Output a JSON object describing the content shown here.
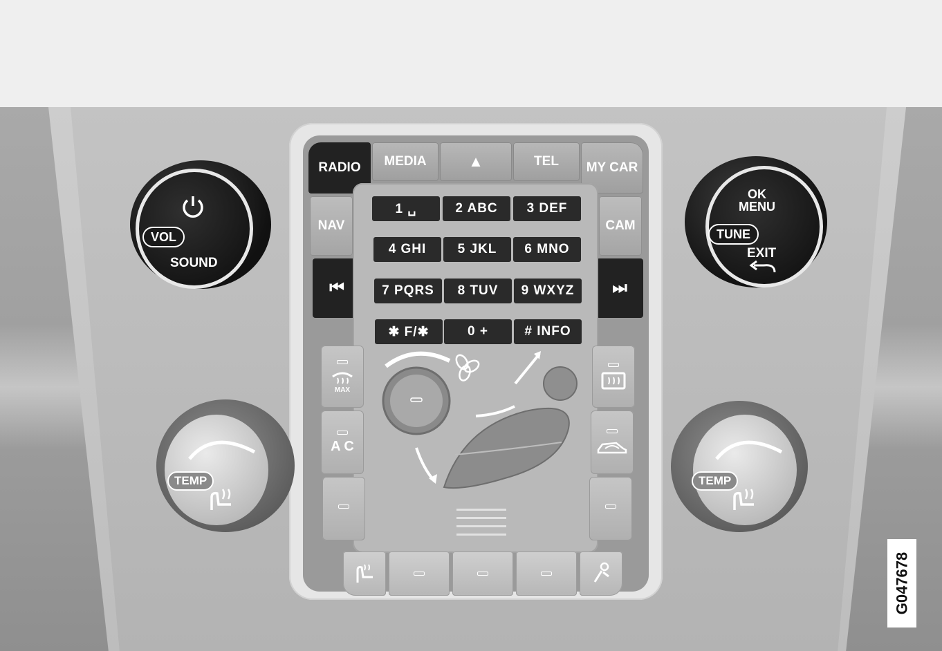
{
  "top_row": {
    "radio": "RADIO",
    "media": "MEDIA",
    "eject": "▲",
    "tel": "TEL",
    "my_car": "MY CAR"
  },
  "side_keys": {
    "nav": "NAV",
    "cam": "CAM",
    "prev": "⏮",
    "next": "⏭"
  },
  "keypad": {
    "k1": "1 ␣",
    "k2": "2 ABC",
    "k3": "3 DEF",
    "k4": "4 GHI",
    "k5": "5 JKL",
    "k6": "6 MNO",
    "k7": "7 PQRS",
    "k8": "8 TUV",
    "k9": "9 WXYZ",
    "kstar": "✱ F/✱",
    "k0": "0 +",
    "khash": "# INFO"
  },
  "left_knob": {
    "power_icon": "power-icon",
    "vol": "VOL",
    "sound": "SOUND"
  },
  "right_knob": {
    "ok_menu": "OK\nMENU",
    "tune": "TUNE",
    "exit": "EXIT",
    "back_icon": "back-arrow-icon"
  },
  "climate": {
    "max_defrost": "MAX",
    "ac": "A C",
    "temp_left": "TEMP",
    "temp_right": "TEMP"
  },
  "image_code": "G047678"
}
